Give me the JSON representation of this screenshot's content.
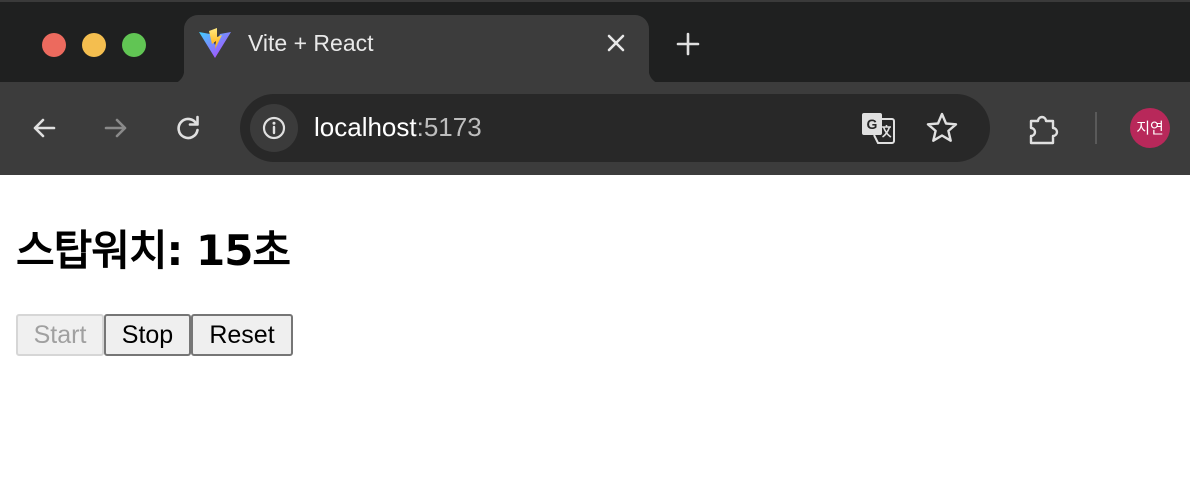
{
  "browser": {
    "tab": {
      "title": "Vite + React",
      "favicon": "vite-logo"
    },
    "toolbar": {
      "url_host": "localhost",
      "url_port": ":5173",
      "profile_initials": "지연"
    },
    "icons": [
      "back-arrow-icon",
      "forward-arrow-icon",
      "reload-icon",
      "info-icon",
      "translate-icon",
      "star-icon",
      "extensions-icon",
      "close-icon",
      "plus-icon"
    ]
  },
  "page": {
    "title": "스탑워치: 15초",
    "buttons": {
      "start_label": "Start",
      "stop_label": "Stop",
      "reset_label": "Reset"
    },
    "start_disabled": true
  }
}
